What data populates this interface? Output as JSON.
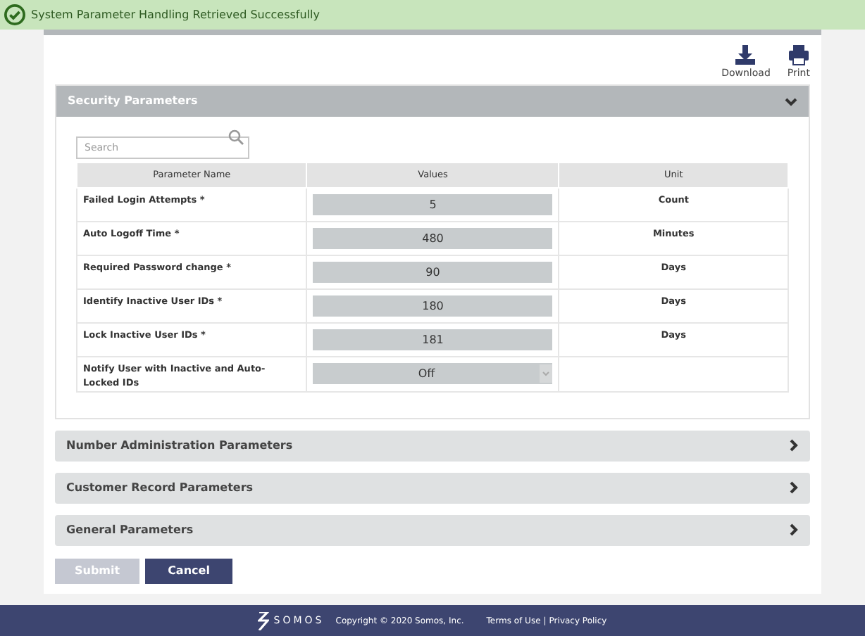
{
  "toast": {
    "message": "System Parameter Handling Retrieved Successfully"
  },
  "actions": [
    {
      "kind": "download",
      "label": "Download"
    },
    {
      "kind": "print",
      "label": "Print"
    }
  ],
  "sections": [
    {
      "title": "Security Parameters",
      "expanded": true,
      "search": {
        "placeholder": "Search"
      },
      "table": {
        "columns": [
          "Parameter Name",
          "Values",
          "Unit"
        ],
        "rows": [
          {
            "name": "Failed Login Attempts *",
            "kind": "input",
            "value": "5",
            "unit": "Count"
          },
          {
            "name": "Auto Logoff Time *",
            "kind": "input",
            "value": "480",
            "unit": "Minutes"
          },
          {
            "name": "Required Password change *",
            "kind": "input",
            "value": "90",
            "unit": "Days"
          },
          {
            "name": "Identify Inactive User IDs *",
            "kind": "input",
            "value": "180",
            "unit": "Days"
          },
          {
            "name": "Lock Inactive User IDs *",
            "kind": "input",
            "value": "181",
            "unit": "Days"
          },
          {
            "name": "Notify User with Inactive and Auto-Locked IDs",
            "kind": "select",
            "value": "Off"
          }
        ]
      }
    },
    {
      "title": "Number Administration Parameters",
      "expanded": false
    },
    {
      "title": "Customer Record Parameters",
      "expanded": false
    },
    {
      "title": "General Parameters",
      "expanded": false
    }
  ],
  "buttons": [
    {
      "label": "Submit",
      "disabled": true
    },
    {
      "label": "Cancel",
      "disabled": false
    }
  ],
  "footer": {
    "logo": "SOMOS",
    "copyright": "Copyright © 2020 Somos, Inc.",
    "links": [
      "Terms of Use",
      "Privacy Policy"
    ],
    "separator": "|"
  }
}
